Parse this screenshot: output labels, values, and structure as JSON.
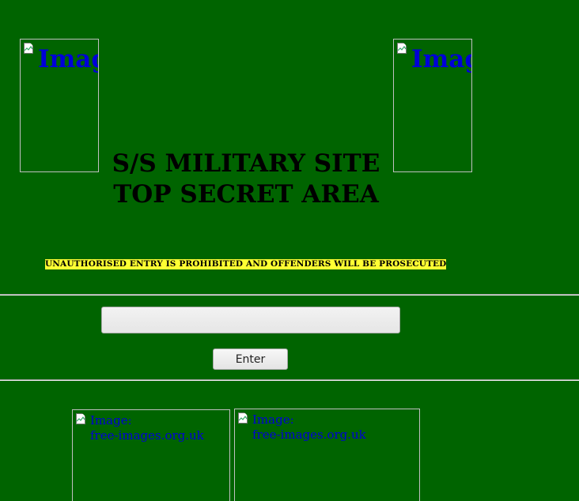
{
  "header": {
    "title_line_1": "S/S MILITARY SITE",
    "title_line_2": "TOP SECRET AREA"
  },
  "warning": {
    "text": "UNAUTHORISED ENTRY IS PROHIBITED AND OFFENDERS WILL BE PROSECUTED",
    "background": "#ffff33"
  },
  "form": {
    "input_value": "",
    "button_label": "Enter"
  },
  "images": {
    "top_left_alt": "Image: free-images.org.uk",
    "top_right_alt": "Image: free-images.org.uk",
    "bottom_left_alt_line_1": "Image:",
    "bottom_left_alt_line_2": "free-images.org.uk",
    "bottom_right_alt_line_1": "Image:",
    "bottom_right_alt_line_2": "free-images.org.uk",
    "icon": "broken-image-icon"
  },
  "colors": {
    "page_background": "#006400",
    "link_text": "#0000d8",
    "title_text": "#000000"
  }
}
